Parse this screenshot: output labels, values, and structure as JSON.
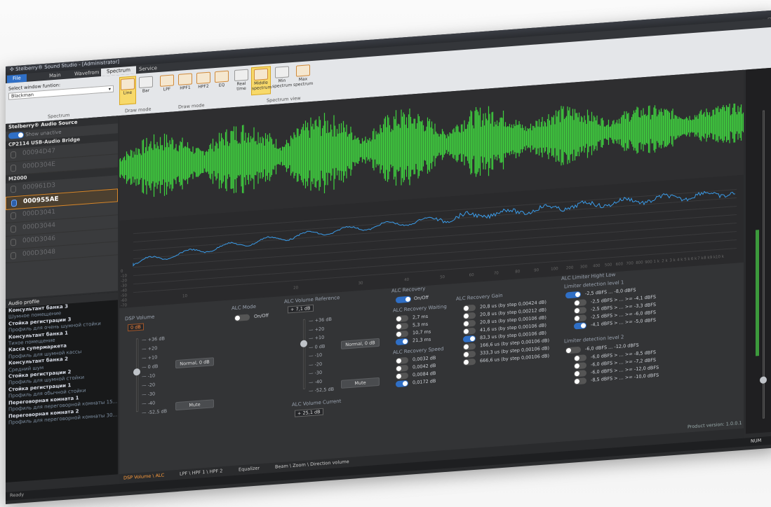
{
  "window": {
    "title": "Stelberry® Sound Studio - [Administrator]",
    "tabs": [
      "File",
      "Main",
      "Wavefrom",
      "Spectrum",
      "Service"
    ],
    "active_tab": "Spectrum"
  },
  "ribbon": {
    "select_label": "Select window funtion:",
    "select_value": "Blackman",
    "spectrum_group": "Spectrum",
    "draw_mode_group1": "Draw mode",
    "draw_mode_group2": "Draw mode",
    "spectrum_view_group": "Spectrum view",
    "buttons": {
      "line": "Line",
      "bar": "Bar",
      "lpf": "LPF",
      "hpf1": "HPF1",
      "hpf2": "HPF2",
      "eq": "EQ",
      "real_time": "Real time",
      "middle_spectrum": "Middle spectrum",
      "min_spectrum": "Min spectrum",
      "max_spectrum": "Max spectrum"
    }
  },
  "sources": {
    "header": "Stelberry® Audio Source",
    "show_unactive": "Show unactive",
    "groups": [
      {
        "name": "CP2114 USB-Audio Bridge",
        "devices": [
          "00094D47",
          "000D304E"
        ]
      },
      {
        "name": "M2000",
        "devices": [
          "000961D3",
          "000955AE",
          "000D3041",
          "000D3044",
          "000D3046",
          "000D3048"
        ]
      }
    ],
    "selected": "000955AE"
  },
  "audio_profile": {
    "header": "Audio profile",
    "items": [
      {
        "text": "Консультант банка 3",
        "style": "b"
      },
      {
        "text": "Шумное помещение",
        "style": "d"
      },
      {
        "text": "Стойка регистрации 3",
        "style": "b"
      },
      {
        "text": "Профиль для очень шумной стойки",
        "style": "d"
      },
      {
        "text": "Консультант банка 1",
        "style": "b"
      },
      {
        "text": "Тихое помещение",
        "style": "d"
      },
      {
        "text": "Касса супермаркета",
        "style": "b"
      },
      {
        "text": "Профиль для шумной кассы",
        "style": "d"
      },
      {
        "text": "Консультант банка 2",
        "style": "b"
      },
      {
        "text": "Средний шум",
        "style": "d"
      },
      {
        "text": "Стойка регистрации 2",
        "style": "b"
      },
      {
        "text": "Профиль для шумной стойки",
        "style": "d"
      },
      {
        "text": "Стойка регистрации 1",
        "style": "b"
      },
      {
        "text": "Профиль для обычной стойки",
        "style": "d"
      },
      {
        "text": "Переговорная комната 1",
        "style": "b"
      },
      {
        "text": "Профиль для переговорной комнаты 15...",
        "style": "d"
      },
      {
        "text": "Переговорная комната 2",
        "style": "b"
      },
      {
        "text": "Профиль для переговорной комнаты 30...",
        "style": "d"
      }
    ]
  },
  "spectrum_axis": {
    "db_ticks": [
      "0",
      "-10",
      "-20",
      "-30",
      "-40",
      "-50",
      "-60",
      "-70",
      "-80",
      "-90",
      "-100",
      "-110",
      "-120",
      "-130",
      "-140",
      "-150",
      "-160",
      "-170",
      "-180"
    ],
    "freq_ticks": [
      "10",
      "20",
      "30",
      "40",
      "50",
      "60",
      "70",
      "80",
      "90",
      "100",
      "200",
      "300",
      "400",
      "500",
      "600",
      "700",
      "800",
      "900",
      "1 k",
      "2 k",
      "3 k",
      "4 k",
      "5 k",
      "6 k",
      "7 k",
      "8 k",
      "9 k",
      "10 k"
    ]
  },
  "dsp": {
    "dsp_volume_label": "DSP Volume",
    "dsp_volume_value": "0 dB",
    "scale": [
      "+36 dB",
      "+20",
      "+10",
      "0 dB",
      "-10",
      "-20",
      "-30",
      "-40",
      "-52,5 dB"
    ],
    "normal_button": "Normal, 0 dB",
    "mute_button": "Mute",
    "alc_mode_label": "ALC Mode",
    "alc_mode_onoff": "On/Off",
    "alc_ref_label": "ALC Volume Reference",
    "alc_ref_value": "+ 7,1 dB",
    "alc_current_label": "ALC Volume Current",
    "alc_current_value": "+ 25,1 dB",
    "alc_recovery_label": "ALC Recovery",
    "alc_recovery_onoff": "On/Off",
    "alc_recovery_waiting_label": "ALC Recovery Waiting",
    "alc_recovery_waiting": [
      "2,7 ms",
      "5,3 ms",
      "10,7 ms",
      "21,3 ms"
    ],
    "alc_recovery_speed_label": "ALC Recovery Speed",
    "alc_recovery_speed": [
      "0,0032 dB",
      "0,0042 dB",
      "0,0084 dB",
      "0,0172 dB"
    ],
    "alc_recovery_gain_label": "ALC Recovery Gain",
    "alc_recovery_gain": [
      "20,8 us (by step 0,00424 dB)",
      "20,8 us (by step 0,00212 dB)",
      "20,8 us (by step 0,00106 dB)",
      "41,6 us (by step 0,00106 dB)",
      "83,3 us (by step 0,00106 dB)",
      "166,6 us (by step 0,00106 dB)",
      "333,3 us (by step 0,00106 dB)",
      "666,6 us (by step 0,00106 dB)"
    ],
    "limiter_label": "ALC Limiter Hight Low",
    "limiter_level1_label": "Limiter detection level 1",
    "limiter_level1_main": "-2,5 dBFS ... -8,0 dBFS",
    "limiter_level1": [
      "-2,5 dBFS > ... >= -4,1 dBFS",
      "-2,5 dBFS > ... >= -3,3 dBFS",
      "-2,5 dBFS > ... >= -6,0 dBFS",
      "-4,1 dBFS > ... >= -5,0 dBFS"
    ],
    "limiter_level2_label": "Limiter detection level 2",
    "limiter_level2_main": "-6,0 dBFS ... -12,0 dBFS",
    "limiter_level2": [
      "-6,0 dBFS > ... >= -8,5 dBFS",
      "-6,0 dBFS > ... >= -7,2 dBFS",
      "-6,0 dBFS > ... >= -12,0 dBFS",
      "-8,5 dBFS > ... >= -10,0 dBFS"
    ]
  },
  "bottom_tabs": [
    "DSP Volume \\ ALC",
    "LPF \\ HPF 1 \\ HPF 2",
    "Equalizer",
    "Beam \\ Zoom \\ Direction volume"
  ],
  "status": {
    "left": "Ready",
    "version": "Product version: 1.0.0.1",
    "num": "NUM"
  },
  "colors": {
    "waveform": "#3fd23f",
    "spectrum": "#3a9be8",
    "accent": "#2f6fc6",
    "selected_border": "#d6862a"
  }
}
